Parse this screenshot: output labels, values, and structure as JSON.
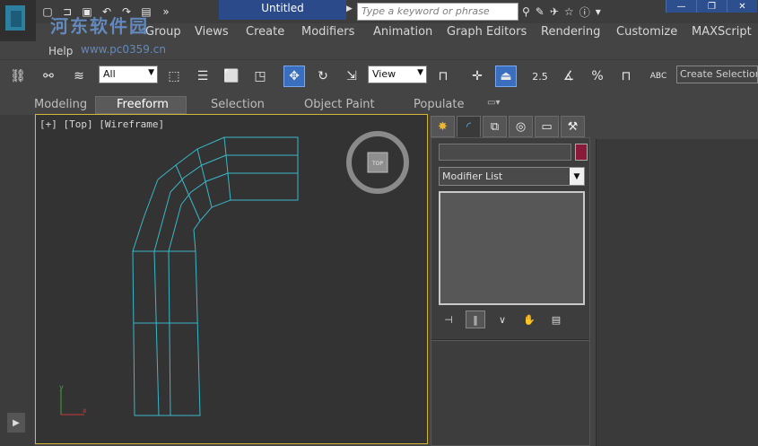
{
  "title_bar": {
    "document_title": "Untitled",
    "search_placeholder": "Type a keyword or phrase"
  },
  "watermark": {
    "text_cn": "河东软件园",
    "url": "www.pc0359.cn"
  },
  "menu": {
    "items": [
      "Group",
      "Views",
      "Create",
      "Modifiers",
      "Animation",
      "Graph Editors",
      "Rendering",
      "Customize",
      "MAXScript"
    ],
    "help": "Help"
  },
  "toolbar": {
    "selection_filter": "All",
    "ref_coord": "View",
    "snap_angle": "2.5",
    "percent_snap": "%",
    "named_selection_placeholder": "Create Selection S",
    "spell_label": "ABC"
  },
  "ribbon": {
    "tabs": [
      "Modeling",
      "Freeform",
      "Selection",
      "Object Paint",
      "Populate"
    ],
    "active": "Freeform"
  },
  "viewport": {
    "label": "[+] [Top] [Wireframe]",
    "viewcube_label": "TOP",
    "axis_x": "x",
    "axis_y": "y"
  },
  "command_panel": {
    "modifier_list": "Modifier List"
  },
  "colors": {
    "object_color": "#8a1a3a",
    "wire_color": "#3ab7c8",
    "viewport_border": "#d5b43a"
  }
}
